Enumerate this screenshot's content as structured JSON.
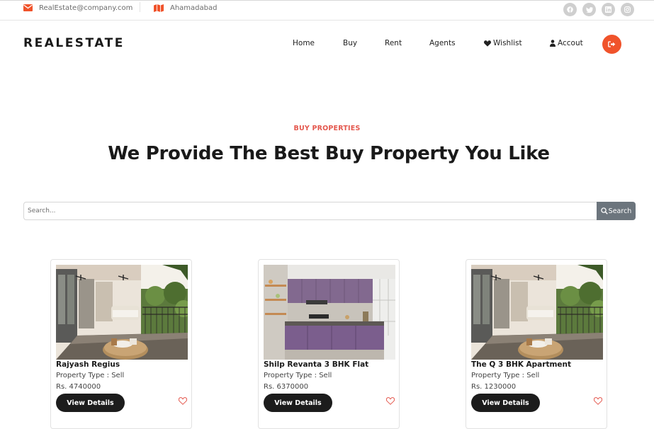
{
  "topbar": {
    "email": "RealEstate@company.com",
    "location": "Ahamadabad",
    "socials": [
      {
        "name": "facebook-icon"
      },
      {
        "name": "twitter-icon"
      },
      {
        "name": "linkedin-icon"
      },
      {
        "name": "instagram-icon"
      }
    ]
  },
  "brand": {
    "logo": "REALESTATE",
    "accent": "#f0532b"
  },
  "nav": {
    "home": "Home",
    "buy": "Buy",
    "rent": "Rent",
    "agents": "Agents",
    "wishlist": "Wishlist",
    "account": "Accout"
  },
  "hero": {
    "eyebrow": "BUY PROPERTIES",
    "headline": "We Provide The Best Buy Property You Like"
  },
  "search": {
    "placeholder": "Search...",
    "button_label": "Search"
  },
  "listings": [
    {
      "title": "Rajyash Regius",
      "type": "Property Type : Sell",
      "price": "Rs. 4740000",
      "button": "View Details",
      "image": "balcony-photo"
    },
    {
      "title": "Shilp Revanta 3 BHK Flat",
      "type": "Property Type : Sell",
      "price": "Rs. 6370000",
      "button": "View Details",
      "image": "kitchen-photo"
    },
    {
      "title": "The Q 3 BHK Apartment",
      "type": "Property Type : Sell",
      "price": "Rs. 1230000",
      "button": "View Details",
      "image": "balcony-photo"
    }
  ]
}
